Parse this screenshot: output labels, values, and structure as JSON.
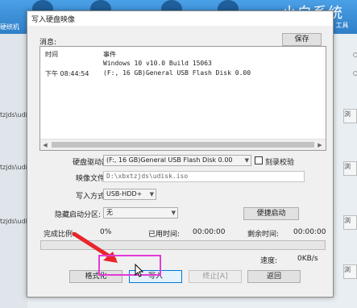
{
  "background": {
    "title": "小白系统",
    "title_sub": "官网 工具",
    "left_items": [
      "硬统机",
      "tzjds\\udi",
      "tzjds\\udi",
      "tzjds\\udi"
    ],
    "right_buttons": [
      "浏",
      "浏",
      "浏",
      "浏"
    ]
  },
  "dialog": {
    "title": "写入硬盘映像",
    "message_label": "消息:",
    "save_button": "保存",
    "log": {
      "col_time": "时间",
      "col_event": "事件",
      "rows": [
        {
          "time": "",
          "event": "Windows 10 v10.0 Build 15063"
        },
        {
          "time": "下午 08:44:54",
          "event": "(F:, 16 GB)General USB Flash Disk  0.00"
        }
      ]
    },
    "drive_label": "硬盘驱动器:",
    "drive_value": "(F:, 16 GB)General USB Flash Disk  0.00",
    "verify_label": "刻录校验",
    "image_label": "映像文件:",
    "image_value": "D:\\xbxtzjds\\udisk.iso",
    "write_mode_label": "写入方式:",
    "write_mode_value": "USB-HDD+",
    "hidden_partition_label": "隐藏启动分区:",
    "hidden_partition_value": "无",
    "quick_boot_button": "便捷启动",
    "completed_label": "完成比例:",
    "completed_value": "0%",
    "elapsed_label": "已用时间:",
    "elapsed_value": "00:00:00",
    "remaining_label": "剩余时间:",
    "remaining_value": "00:00:00",
    "speed_label": "速度:",
    "speed_value": "0KB/s",
    "progress": 0,
    "buttons": {
      "format": "格式化",
      "write": "写入",
      "stop": "终止[A]",
      "back": "返回"
    }
  }
}
